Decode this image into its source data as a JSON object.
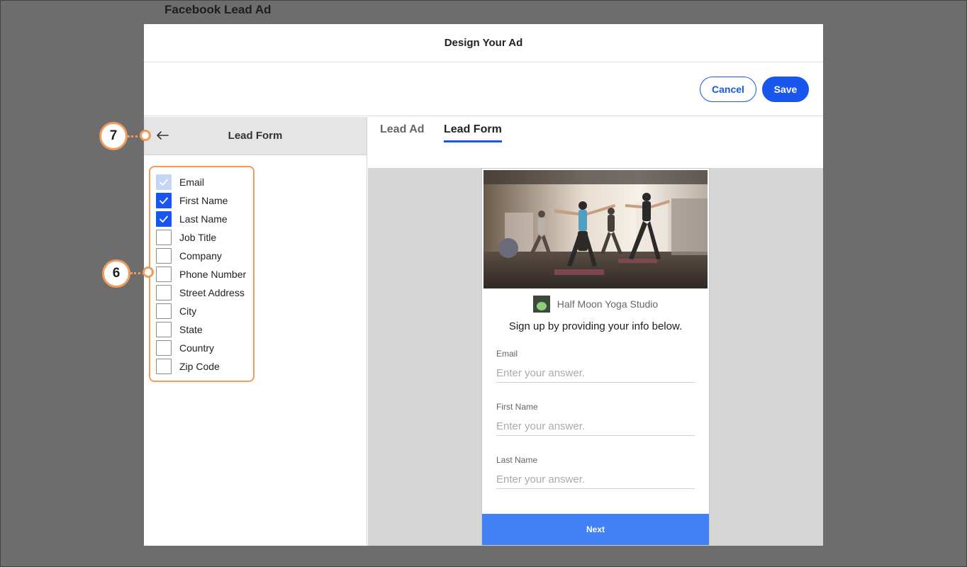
{
  "page": {
    "background_title": "Facebook Lead Ad"
  },
  "modal": {
    "title": "Design Your Ad",
    "cancel_label": "Cancel",
    "save_label": "Save"
  },
  "left_panel": {
    "title": "Lead Form",
    "back_icon": "arrow-left-icon",
    "fields": [
      {
        "label": "Email",
        "state": "checked-disabled"
      },
      {
        "label": "First Name",
        "state": "checked"
      },
      {
        "label": "Last Name",
        "state": "checked"
      },
      {
        "label": "Job Title",
        "state": "unchecked"
      },
      {
        "label": "Company",
        "state": "unchecked"
      },
      {
        "label": "Phone Number",
        "state": "unchecked"
      },
      {
        "label": "Street Address",
        "state": "unchecked"
      },
      {
        "label": "City",
        "state": "unchecked"
      },
      {
        "label": "State",
        "state": "unchecked"
      },
      {
        "label": "Country",
        "state": "unchecked"
      },
      {
        "label": "Zip Code",
        "state": "unchecked"
      }
    ]
  },
  "preview": {
    "tabs": [
      {
        "label": "Lead Ad",
        "active": false
      },
      {
        "label": "Lead Form",
        "active": true
      }
    ],
    "brand_name": "Half Moon Yoga Studio",
    "heading": "Sign up by providing your info below.",
    "form_fields": [
      {
        "label": "Email",
        "placeholder": "Enter your answer."
      },
      {
        "label": "First Name",
        "placeholder": "Enter your answer."
      },
      {
        "label": "Last Name",
        "placeholder": "Enter your answer."
      }
    ],
    "next_label": "Next"
  },
  "callouts": {
    "back": "7",
    "fields": "6"
  },
  "colors": {
    "accent": "#1856ed",
    "next_button": "#4281f5",
    "callout": "#f09a5e",
    "backdrop": "#6d6d6d"
  }
}
